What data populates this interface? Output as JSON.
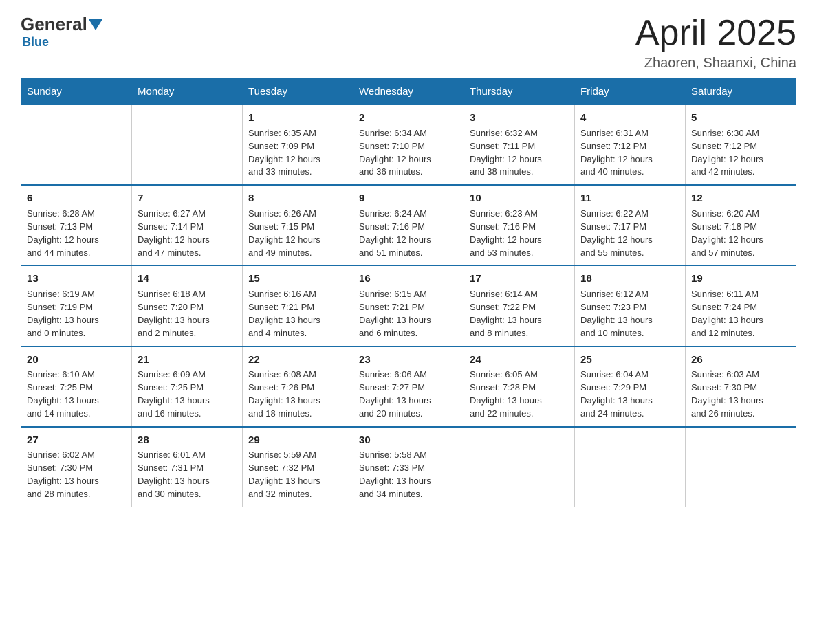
{
  "header": {
    "logo_general": "General",
    "logo_blue": "Blue",
    "month_title": "April 2025",
    "location": "Zhaoren, Shaanxi, China"
  },
  "days_of_week": [
    "Sunday",
    "Monday",
    "Tuesday",
    "Wednesday",
    "Thursday",
    "Friday",
    "Saturday"
  ],
  "weeks": [
    [
      {
        "day": "",
        "info": ""
      },
      {
        "day": "",
        "info": ""
      },
      {
        "day": "1",
        "info": "Sunrise: 6:35 AM\nSunset: 7:09 PM\nDaylight: 12 hours\nand 33 minutes."
      },
      {
        "day": "2",
        "info": "Sunrise: 6:34 AM\nSunset: 7:10 PM\nDaylight: 12 hours\nand 36 minutes."
      },
      {
        "day": "3",
        "info": "Sunrise: 6:32 AM\nSunset: 7:11 PM\nDaylight: 12 hours\nand 38 minutes."
      },
      {
        "day": "4",
        "info": "Sunrise: 6:31 AM\nSunset: 7:12 PM\nDaylight: 12 hours\nand 40 minutes."
      },
      {
        "day": "5",
        "info": "Sunrise: 6:30 AM\nSunset: 7:12 PM\nDaylight: 12 hours\nand 42 minutes."
      }
    ],
    [
      {
        "day": "6",
        "info": "Sunrise: 6:28 AM\nSunset: 7:13 PM\nDaylight: 12 hours\nand 44 minutes."
      },
      {
        "day": "7",
        "info": "Sunrise: 6:27 AM\nSunset: 7:14 PM\nDaylight: 12 hours\nand 47 minutes."
      },
      {
        "day": "8",
        "info": "Sunrise: 6:26 AM\nSunset: 7:15 PM\nDaylight: 12 hours\nand 49 minutes."
      },
      {
        "day": "9",
        "info": "Sunrise: 6:24 AM\nSunset: 7:16 PM\nDaylight: 12 hours\nand 51 minutes."
      },
      {
        "day": "10",
        "info": "Sunrise: 6:23 AM\nSunset: 7:16 PM\nDaylight: 12 hours\nand 53 minutes."
      },
      {
        "day": "11",
        "info": "Sunrise: 6:22 AM\nSunset: 7:17 PM\nDaylight: 12 hours\nand 55 minutes."
      },
      {
        "day": "12",
        "info": "Sunrise: 6:20 AM\nSunset: 7:18 PM\nDaylight: 12 hours\nand 57 minutes."
      }
    ],
    [
      {
        "day": "13",
        "info": "Sunrise: 6:19 AM\nSunset: 7:19 PM\nDaylight: 13 hours\nand 0 minutes."
      },
      {
        "day": "14",
        "info": "Sunrise: 6:18 AM\nSunset: 7:20 PM\nDaylight: 13 hours\nand 2 minutes."
      },
      {
        "day": "15",
        "info": "Sunrise: 6:16 AM\nSunset: 7:21 PM\nDaylight: 13 hours\nand 4 minutes."
      },
      {
        "day": "16",
        "info": "Sunrise: 6:15 AM\nSunset: 7:21 PM\nDaylight: 13 hours\nand 6 minutes."
      },
      {
        "day": "17",
        "info": "Sunrise: 6:14 AM\nSunset: 7:22 PM\nDaylight: 13 hours\nand 8 minutes."
      },
      {
        "day": "18",
        "info": "Sunrise: 6:12 AM\nSunset: 7:23 PM\nDaylight: 13 hours\nand 10 minutes."
      },
      {
        "day": "19",
        "info": "Sunrise: 6:11 AM\nSunset: 7:24 PM\nDaylight: 13 hours\nand 12 minutes."
      }
    ],
    [
      {
        "day": "20",
        "info": "Sunrise: 6:10 AM\nSunset: 7:25 PM\nDaylight: 13 hours\nand 14 minutes."
      },
      {
        "day": "21",
        "info": "Sunrise: 6:09 AM\nSunset: 7:25 PM\nDaylight: 13 hours\nand 16 minutes."
      },
      {
        "day": "22",
        "info": "Sunrise: 6:08 AM\nSunset: 7:26 PM\nDaylight: 13 hours\nand 18 minutes."
      },
      {
        "day": "23",
        "info": "Sunrise: 6:06 AM\nSunset: 7:27 PM\nDaylight: 13 hours\nand 20 minutes."
      },
      {
        "day": "24",
        "info": "Sunrise: 6:05 AM\nSunset: 7:28 PM\nDaylight: 13 hours\nand 22 minutes."
      },
      {
        "day": "25",
        "info": "Sunrise: 6:04 AM\nSunset: 7:29 PM\nDaylight: 13 hours\nand 24 minutes."
      },
      {
        "day": "26",
        "info": "Sunrise: 6:03 AM\nSunset: 7:30 PM\nDaylight: 13 hours\nand 26 minutes."
      }
    ],
    [
      {
        "day": "27",
        "info": "Sunrise: 6:02 AM\nSunset: 7:30 PM\nDaylight: 13 hours\nand 28 minutes."
      },
      {
        "day": "28",
        "info": "Sunrise: 6:01 AM\nSunset: 7:31 PM\nDaylight: 13 hours\nand 30 minutes."
      },
      {
        "day": "29",
        "info": "Sunrise: 5:59 AM\nSunset: 7:32 PM\nDaylight: 13 hours\nand 32 minutes."
      },
      {
        "day": "30",
        "info": "Sunrise: 5:58 AM\nSunset: 7:33 PM\nDaylight: 13 hours\nand 34 minutes."
      },
      {
        "day": "",
        "info": ""
      },
      {
        "day": "",
        "info": ""
      },
      {
        "day": "",
        "info": ""
      }
    ]
  ]
}
